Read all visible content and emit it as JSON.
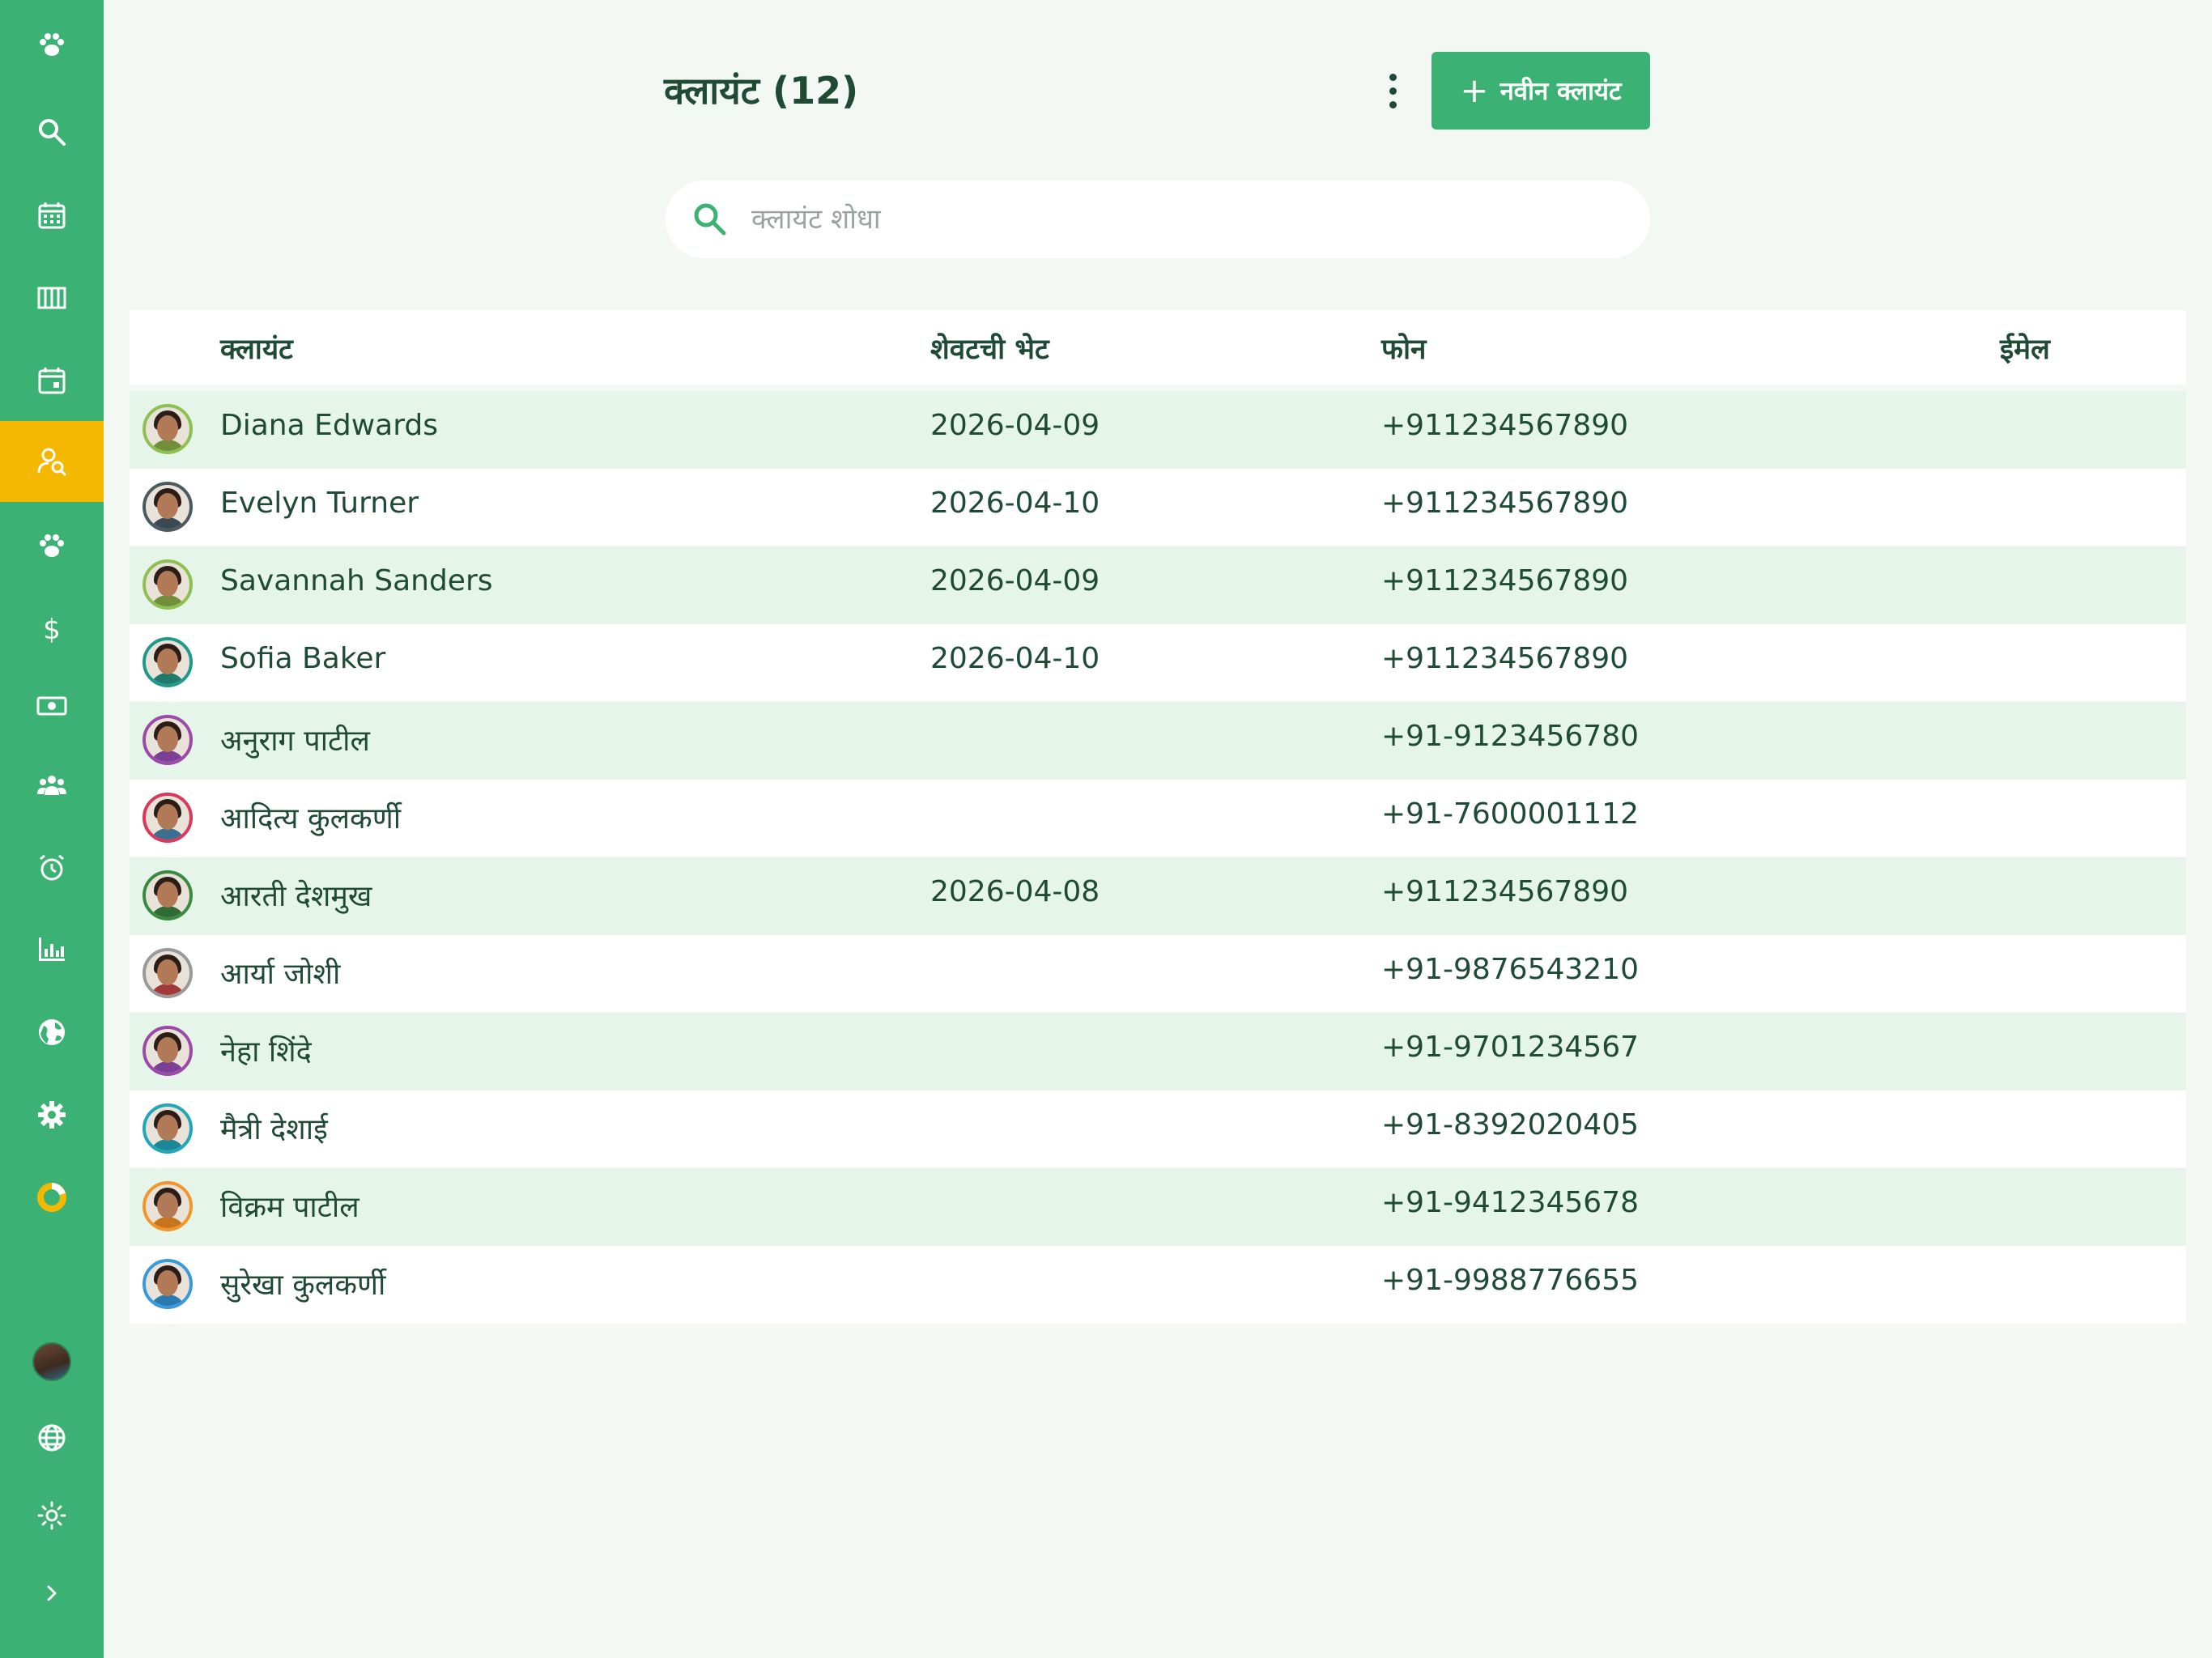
{
  "sidebar": {
    "items": [
      {
        "icon": "paw-icon"
      },
      {
        "icon": "search-icon"
      },
      {
        "icon": "calendar-icon"
      },
      {
        "icon": "columns-icon"
      },
      {
        "icon": "calendar-event-icon"
      },
      {
        "icon": "client-search-icon",
        "active": true
      },
      {
        "icon": "paw-icon"
      },
      {
        "icon": "dollar-icon"
      },
      {
        "icon": "cash-icon"
      },
      {
        "icon": "group-icon"
      },
      {
        "icon": "alarm-icon"
      },
      {
        "icon": "bar-chart-icon"
      },
      {
        "icon": "globe-icon"
      },
      {
        "icon": "settings-icon"
      },
      {
        "icon": "donut-icon"
      }
    ],
    "bottom": [
      {
        "icon": "user-avatar"
      },
      {
        "icon": "language-globe-icon"
      },
      {
        "icon": "sun-icon"
      },
      {
        "icon": "chevron-right-icon"
      }
    ],
    "colors": {
      "bg": "#3bb273",
      "active": "#f5b800"
    }
  },
  "header": {
    "title": "क्लायंट (12)",
    "new_client_label": "नवीन क्लायंट"
  },
  "search": {
    "placeholder": "क्लायंट शोधा"
  },
  "table": {
    "columns": {
      "client": "क्लायंट",
      "last_visit": "शेवटची भेट",
      "phone": "फोन",
      "email": "ईमेल"
    },
    "rows": [
      {
        "name": "Diana Edwards",
        "last_visit": "2026-04-09",
        "phone": "+911234567890",
        "email": "",
        "ring": "#8cc152",
        "shirt": "#6f8f3a"
      },
      {
        "name": "Evelyn Turner",
        "last_visit": "2026-04-10",
        "phone": "+911234567890",
        "email": "",
        "ring": "#4a5a5f",
        "shirt": "#3b4a52"
      },
      {
        "name": "Savannah Sanders",
        "last_visit": "2026-04-09",
        "phone": "+911234567890",
        "email": "",
        "ring": "#8cc152",
        "shirt": "#6f8f3a"
      },
      {
        "name": "Sofia Baker",
        "last_visit": "2026-04-10",
        "phone": "+911234567890",
        "email": "",
        "ring": "#1f9a8a",
        "shirt": "#1f7a6c"
      },
      {
        "name": "अनुराग पाटील",
        "last_visit": "",
        "phone": "+91-9123456780",
        "email": "",
        "ring": "#9b4aa8",
        "shirt": "#7a3f96"
      },
      {
        "name": "आदित्य कुलकर्णी",
        "last_visit": "",
        "phone": "+91-7600001112",
        "email": "",
        "ring": "#d9395a",
        "shirt": "#3c6e8f"
      },
      {
        "name": "आरती देशमुख",
        "last_visit": "2026-04-08",
        "phone": "+911234567890",
        "email": "",
        "ring": "#3a8a3f",
        "shirt": "#2f6b35"
      },
      {
        "name": "आर्या जोशी",
        "last_visit": "",
        "phone": "+91-9876543210",
        "email": "",
        "ring": "#9a9a9a",
        "shirt": "#a33a3a"
      },
      {
        "name": "नेहा शिंदे",
        "last_visit": "",
        "phone": "+91-9701234567",
        "email": "",
        "ring": "#9b4aa8",
        "shirt": "#7a3f96"
      },
      {
        "name": "मैत्री देशाई",
        "last_visit": "",
        "phone": "+91-8392020405",
        "email": "",
        "ring": "#22a7b8",
        "shirt": "#1b8797"
      },
      {
        "name": "विक्रम पाटील",
        "last_visit": "",
        "phone": "+91-9412345678",
        "email": "",
        "ring": "#f0962a",
        "shirt": "#c7751a"
      },
      {
        "name": "सुरेखा कुलकर्णी",
        "last_visit": "",
        "phone": "+91-9988776655",
        "email": "",
        "ring": "#3a9ad9",
        "shirt": "#2a7ab0"
      }
    ]
  }
}
